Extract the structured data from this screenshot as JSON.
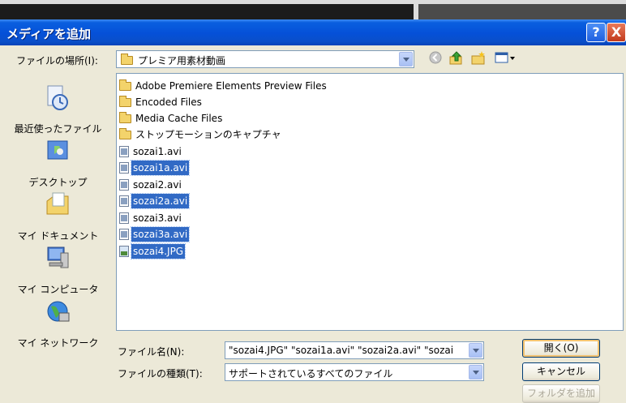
{
  "dialog": {
    "title": "メディアを追加"
  },
  "titlebar_buttons": {
    "help": "?",
    "close": "X"
  },
  "location": {
    "label": "ファイルの場所(I):",
    "value": "プレミア用素材動画"
  },
  "toolbar": {
    "back_icon": "back-icon",
    "up_icon": "up-folder-icon",
    "new_folder_icon": "new-folder-icon",
    "view_icon": "view-menu-icon"
  },
  "places": [
    {
      "label": "最近使ったファイル",
      "icon": "recent-files-icon"
    },
    {
      "label": "デスクトップ",
      "icon": "desktop-icon"
    },
    {
      "label": "マイ ドキュメント",
      "icon": "my-documents-icon"
    },
    {
      "label": "マイ コンピュータ",
      "icon": "my-computer-icon"
    },
    {
      "label": "マイ ネットワーク",
      "icon": "my-network-icon"
    }
  ],
  "files": [
    {
      "name": "Adobe Premiere Elements Preview Files",
      "type": "folder",
      "selected": false
    },
    {
      "name": "Encoded Files",
      "type": "folder",
      "selected": false
    },
    {
      "name": "Media Cache Files",
      "type": "folder",
      "selected": false
    },
    {
      "name": "ストップモーションのキャプチャ",
      "type": "folder",
      "selected": false
    },
    {
      "name": "sozai1.avi",
      "type": "avi",
      "selected": false
    },
    {
      "name": "sozai1a.avi",
      "type": "avi",
      "selected": true
    },
    {
      "name": "sozai2.avi",
      "type": "avi",
      "selected": false
    },
    {
      "name": "sozai2a.avi",
      "type": "avi",
      "selected": true
    },
    {
      "name": "sozai3.avi",
      "type": "avi",
      "selected": false
    },
    {
      "name": "sozai3a.avi",
      "type": "avi",
      "selected": true
    },
    {
      "name": "sozai4.JPG",
      "type": "jpg",
      "selected": true
    }
  ],
  "filename": {
    "label": "ファイル名(N):",
    "value": "\"sozai4.JPG\" \"sozai1a.avi\" \"sozai2a.avi\" \"sozai"
  },
  "filetype": {
    "label": "ファイルの種類(T):",
    "value": "サポートされているすべてのファイル"
  },
  "buttons": {
    "open": "開く(O)",
    "cancel": "キャンセル",
    "add_folder": "フォルダを追加"
  }
}
